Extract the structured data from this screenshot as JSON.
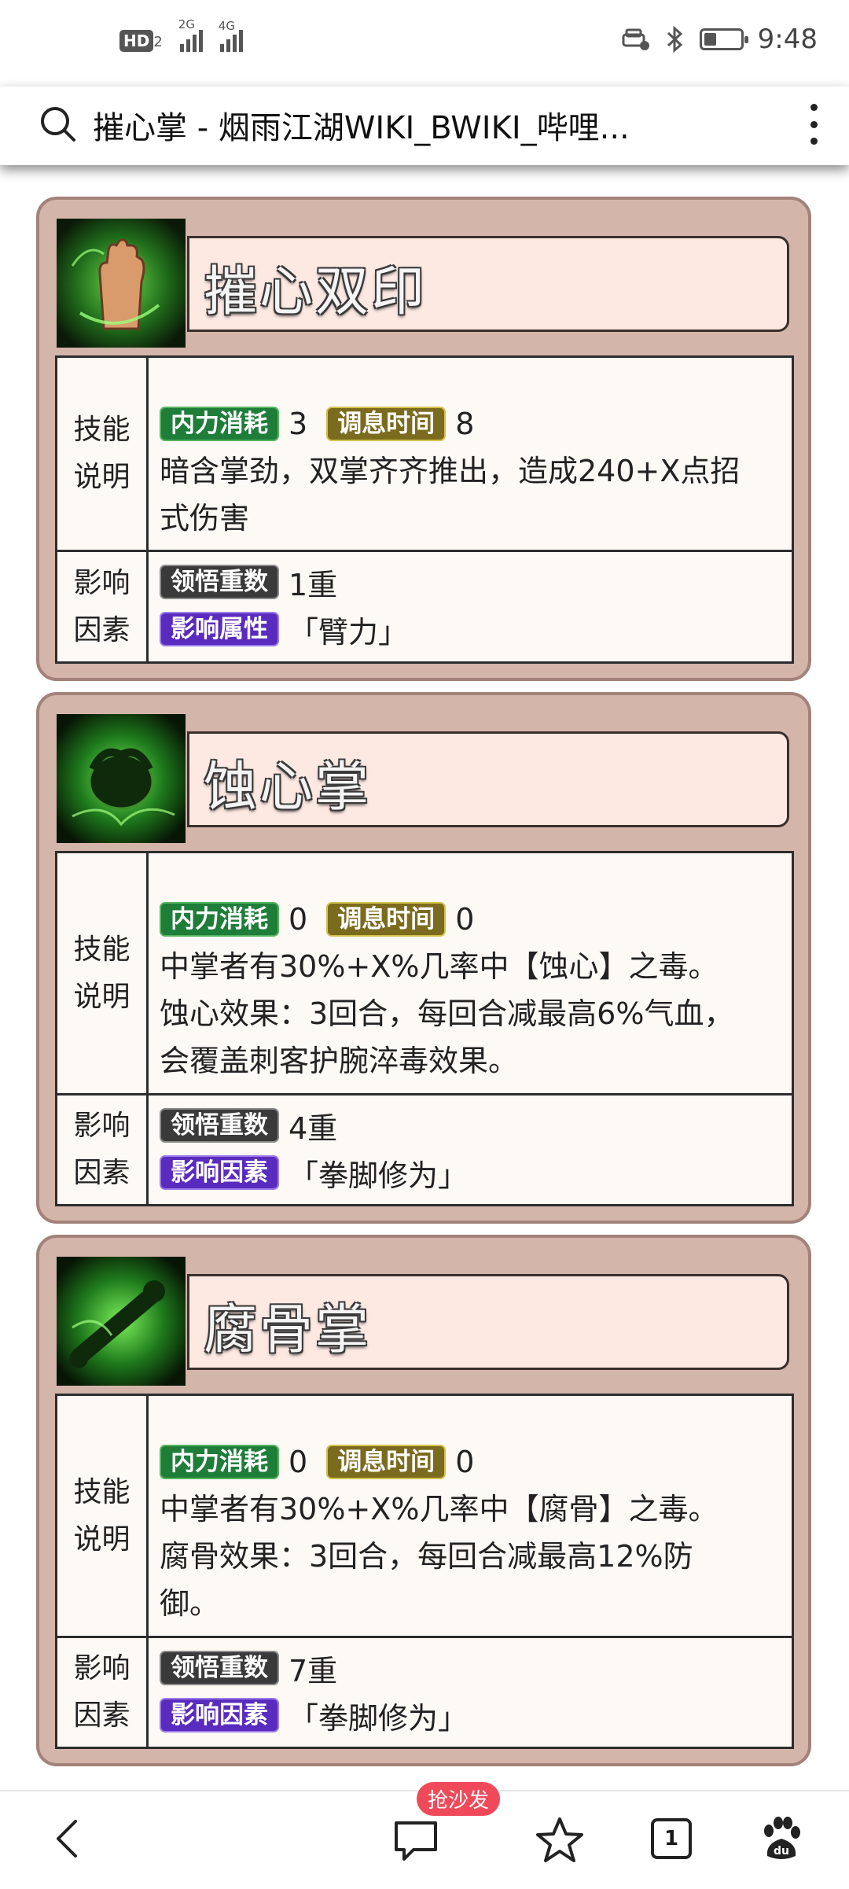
{
  "status_bar": {
    "network_badge": "HD",
    "network_sub": "2",
    "sig1_tag": "2G",
    "sig2_tag": "4G",
    "time": "9:48",
    "battery_level": 0.35
  },
  "address_bar": {
    "title": "摧心掌 - 烟雨江湖WIKI_BWIKI_哔哩..."
  },
  "skills": [
    {
      "name": "摧心双印",
      "desc_label": [
        "技能",
        "说明"
      ],
      "neili_tag": "内力消耗",
      "neili_value": "3",
      "tiaoxi_tag": "调息时间",
      "tiaoxi_value": "8",
      "description": "暗含掌劲，双掌齐齐推出，造成240+X点招\n式伤害",
      "factor_label": [
        "影响",
        "因素"
      ],
      "lingwu_tag": "领悟重数",
      "lingwu_value": "1重",
      "attr_tag": "影响属性",
      "attr_value": "「臂力」"
    },
    {
      "name": "蚀心掌",
      "desc_label": [
        "技能",
        "说明"
      ],
      "neili_tag": "内力消耗",
      "neili_value": "0",
      "tiaoxi_tag": "调息时间",
      "tiaoxi_value": "0",
      "description": "中掌者有30%+X%几率中【蚀心】之毒。\n蚀心效果：3回合，每回合减最高6%气血，\n会覆盖刺客护腕淬毒效果。",
      "factor_label": [
        "影响",
        "因素"
      ],
      "lingwu_tag": "领悟重数",
      "lingwu_value": "4重",
      "attr_tag": "影响因素",
      "attr_value": "「拳脚修为」"
    },
    {
      "name": "腐骨掌",
      "desc_label": [
        "技能",
        "说明"
      ],
      "neili_tag": "内力消耗",
      "neili_value": "0",
      "tiaoxi_tag": "调息时间",
      "tiaoxi_value": "0",
      "description": "中掌者有30%+X%几率中【腐骨】之毒。\n腐骨效果：3回合，每回合减最高12%防\n御。",
      "factor_label": [
        "影响",
        "因素"
      ],
      "lingwu_tag": "领悟重数",
      "lingwu_value": "7重",
      "attr_tag": "影响因素",
      "attr_value": "「拳脚修为」"
    }
  ],
  "bottom_nav": {
    "comment_badge": "抢沙发",
    "tabs_count": "1",
    "icons": [
      "back-icon",
      "comment-icon",
      "star-icon",
      "tabs-icon",
      "baidu-paw-icon"
    ]
  },
  "colors": {
    "card_bg": "#d3b5aa",
    "name_bg": "#fde8e2",
    "tag_green": "#1f7d3a",
    "tag_olive": "#7b6b1e",
    "tag_gray": "#3a3a3a",
    "tag_purple": "#5a2bbf",
    "badge_red": "#f04a5a"
  }
}
